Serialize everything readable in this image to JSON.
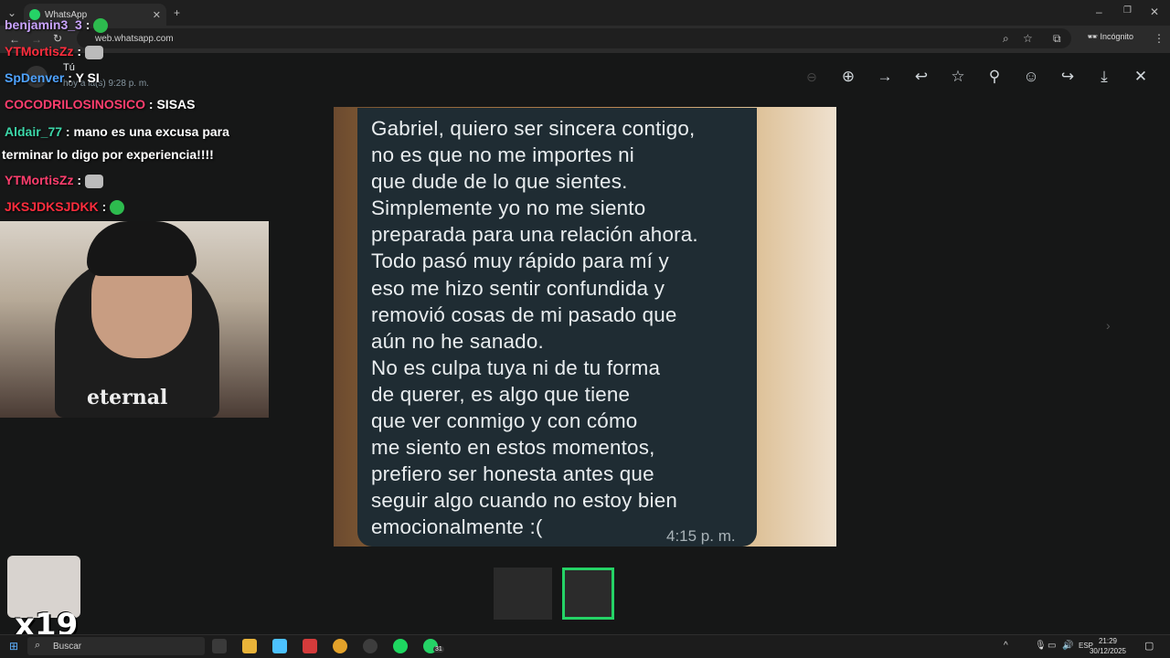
{
  "browser": {
    "tab_title": "WhatsApp",
    "url": "web.whatsapp.com",
    "incognito_label": "Incógnito"
  },
  "viewer": {
    "sender_name": "Tú",
    "sent_time": "hoy a la(s) 9:28 p. m.",
    "tools": [
      "zoom-in-icon",
      "forward-arrow-icon",
      "reply-icon",
      "star-icon",
      "pin-icon",
      "emoji-icon",
      "share-icon",
      "download-icon",
      "close-icon"
    ]
  },
  "message": {
    "text": "Gabriel, quiero ser sincera contigo,\nno es que no me importes ni\nque dude de lo que sientes.\nSimplemente yo no me siento\npreparada para una relación ahora.\nTodo pasó muy rápido para mí y\neso me hizo sentir confundida y\nremovió cosas de mi pasado que\naún no he sanado.\nNo es culpa tuya ni de tu forma\nde querer, es algo que tiene\nque ver conmigo y con cómo\nme siento en estos momentos,\nprefiero ser honesta antes que\nseguir algo cuando no estoy bien\nemocionalmente :(",
    "time": "4:15 p. m."
  },
  "chat": [
    {
      "user": "benjamin3_3",
      "sep": " :",
      "text": ""
    },
    {
      "user": "YTMortisZz",
      "sep": " :",
      "text": ""
    },
    {
      "user": "SpDenver",
      "sep": " :",
      "text": "Y SI"
    },
    {
      "user": "COCODRILOSINOSICO",
      "sep": " :",
      "text": "SISAS"
    },
    {
      "user": "Aldair_77",
      "sep": " :",
      "text": "mano es una excusa para"
    },
    {
      "user": "",
      "sep": "",
      "text": "terminar lo digo por experiencia!!!!"
    },
    {
      "user": "YTMortisZz",
      "sep": " :",
      "text": ""
    },
    {
      "user": "JKSJDKSJDKK",
      "sep": " :",
      "text": ""
    }
  ],
  "overlay": {
    "multiplier": "x19",
    "shirt_text": "eternal"
  },
  "taskbar": {
    "search_placeholder": "Buscar",
    "language": "ESP",
    "time": "21:29",
    "date": "30/12/2025",
    "whatsapp_badge": "31"
  },
  "colors": {
    "whatsapp_green": "#25d366",
    "bubble": "#1f2c33",
    "viewer_bg": "#161717"
  }
}
